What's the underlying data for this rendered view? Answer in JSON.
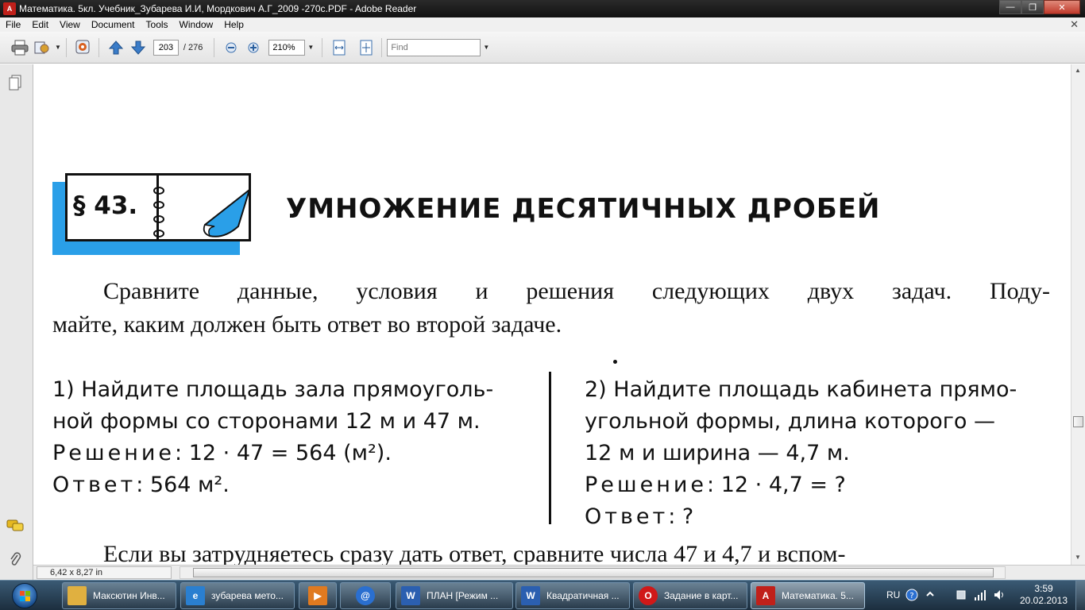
{
  "window": {
    "title": "Математика. 5кл. Учебник_Зубарева И.И, Мордкович А.Г_2009 -270с.PDF - Adobe Reader",
    "app_icon_label": "A"
  },
  "menu": [
    "File",
    "Edit",
    "View",
    "Document",
    "Tools",
    "Window",
    "Help"
  ],
  "toolbar": {
    "page_current": "203",
    "page_total": "/ 276",
    "zoom": "210%",
    "find_placeholder": "Find"
  },
  "document": {
    "section_number": "§ 43.",
    "section_title": "УМНОЖЕНИЕ ДЕСЯТИЧНЫХ ДРОБЕЙ",
    "intro_line1": "Сравните данные, условия и решения следующих двух задач. Поду-",
    "intro_line2": "майте, каким должен быть ответ во второй задаче.",
    "left": {
      "line1": "1) Найдите площадь зала прямоуголь-",
      "line2": "ной формы со сторонами 12 м и 47 м.",
      "solution_label": "Решение",
      "solution_value": ": 12 · 47 = 564 (м²).",
      "answer_label": "Ответ",
      "answer_value": ": 564 м²."
    },
    "right": {
      "line1": "2) Найдите площадь кабинета прямо-",
      "line2": "угольной формы, длина которого —",
      "line3": "12 м и ширина — 4,7 м.",
      "solution_label": "Решение",
      "solution_value": ": 12 · 4,7 = ?",
      "answer_label": "Ответ",
      "answer_value": ": ?"
    },
    "bottom_text": "Если вы затрудняетесь сразу дать ответ, сравните числа 47 и 4,7 и вспом-"
  },
  "status": {
    "page_size": "6,42 x 8,27 in"
  },
  "taskbar": {
    "items": [
      {
        "label": "Максютин Инв...",
        "icon": "folder-icon",
        "color": "#e0b040"
      },
      {
        "label": "зубарева мето...",
        "icon": "ie-icon",
        "color": "#2a7fd0"
      },
      {
        "label": "",
        "icon": "media-player-icon",
        "color": "#e07a20"
      },
      {
        "label": "",
        "icon": "browser-globe-icon",
        "color": "#2a6fd0"
      },
      {
        "label": "ПЛАН [Режим ...",
        "icon": "word-icon",
        "color": "#2b5fb0"
      },
      {
        "label": "Квадратичная ...",
        "icon": "word-icon",
        "color": "#2b5fb0"
      },
      {
        "label": "Задание в карт...",
        "icon": "opera-icon",
        "color": "#d01818"
      },
      {
        "label": "Математика. 5...",
        "icon": "pdf-icon",
        "color": "#c0201a"
      }
    ],
    "lang": "RU",
    "time": "3:59",
    "date": "20.02.2013"
  }
}
